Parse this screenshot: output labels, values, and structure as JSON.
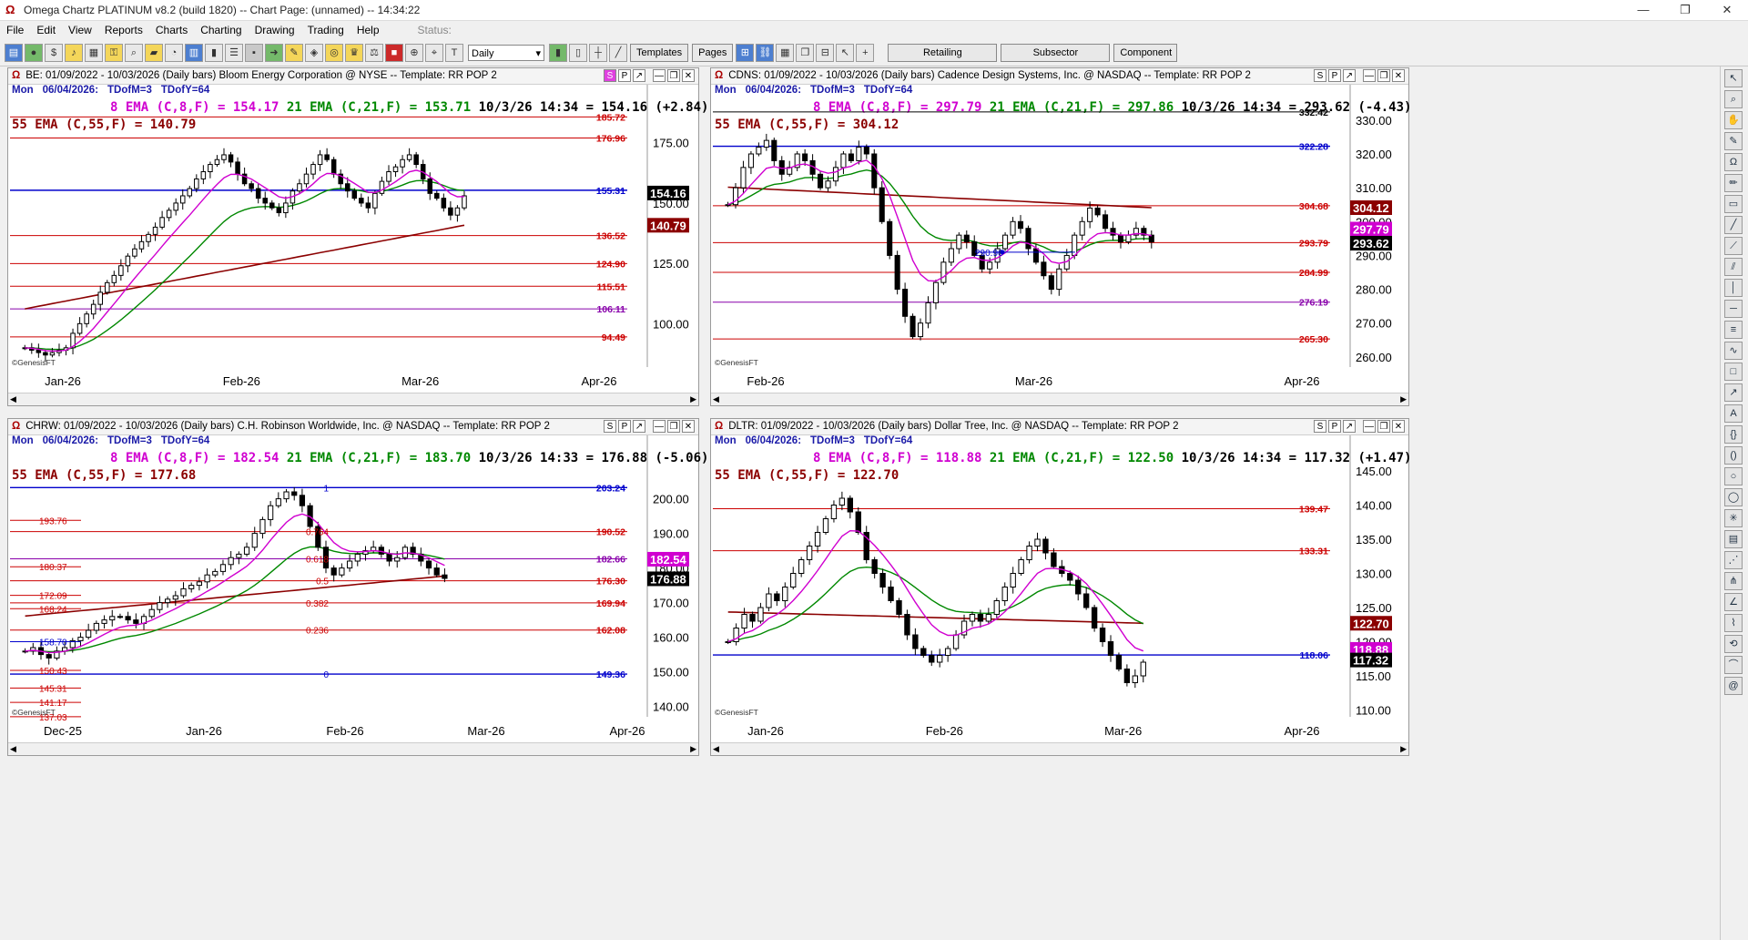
{
  "window": {
    "title": "Omega Chartz PLATINUM v8.2 (build 1820)  --  Chart Page: (unnamed)  --  14:34:22",
    "controls": [
      "—",
      "❐",
      "✕"
    ]
  },
  "menu": {
    "items": [
      "File",
      "Edit",
      "View",
      "Reports",
      "Charts",
      "Charting",
      "Drawing",
      "Trading",
      "Help"
    ],
    "status_label": "Status:"
  },
  "toolbar": {
    "interval": "Daily",
    "buttons": [
      "Templates",
      "Pages"
    ],
    "wide_buttons": [
      "Retailing",
      "Subsector",
      "Component"
    ]
  },
  "pane_buttons": [
    "S",
    "P",
    "↗",
    "—",
    "❐",
    "✕"
  ],
  "genesis": "©GenesisFT",
  "panes": [
    {
      "id": "be",
      "header": "BE:  01/09/2022 - 10/03/2026  (Daily bars)   Bloom Energy Corporation @ NYSE  --  Template: RR POP 2",
      "mon": "Mon",
      "date": "06/04/2026:",
      "tdofm": "TDofM=3",
      "tdofy": "TDofY=64",
      "ema8": "8 EMA (C,8,F) = 154.17",
      "ema21": "21 EMA (C,21,F) = 153.71",
      "quote": "10/3/26 14:34 = 154.16 (+2.84)",
      "ema55": "55 EMA (C,55,F) = 140.79",
      "xlabels": [
        "Jan-26",
        "Feb-26",
        "Mar-26",
        "Apr-26"
      ],
      "chart_data": {
        "type": "candlestick",
        "ylim": [
          82,
          190
        ],
        "yticks": [
          "175.00",
          "150.00",
          "125.00",
          "100.00"
        ],
        "levels": [
          {
            "v": 185.72,
            "label": "185.72",
            "color": "#cc0000"
          },
          {
            "v": 176.96,
            "label": "176.96",
            "color": "#cc0000"
          },
          {
            "v": 155.31,
            "label": "155.31",
            "color": "#0000cc"
          },
          {
            "v": 136.52,
            "label": "136.52",
            "color": "#cc0000"
          },
          {
            "v": 124.9,
            "label": "124.90",
            "color": "#cc0000"
          },
          {
            "v": 115.51,
            "label": "115.51",
            "color": "#cc0000"
          },
          {
            "v": 106.11,
            "label": "106.11",
            "color": "#8800aa"
          },
          {
            "v": 94.49,
            "label": "94.49",
            "color": "#cc0000"
          }
        ],
        "tags": [
          {
            "v": 154.16,
            "label": "154.16",
            "bg": "#000000"
          },
          {
            "v": 140.79,
            "label": "140.79",
            "bg": "#8b0000"
          }
        ],
        "close": [
          90,
          89,
          88,
          87,
          88,
          89,
          90,
          96,
          100,
          104,
          108,
          113,
          117,
          120,
          124,
          128,
          131,
          134,
          137,
          140,
          144,
          147,
          150,
          153,
          156,
          160,
          163,
          166,
          168,
          170,
          167,
          162,
          158,
          156,
          152,
          150,
          148,
          146,
          150,
          155,
          158,
          162,
          166,
          170,
          168,
          162,
          158,
          155,
          152,
          150,
          148,
          154,
          159,
          163,
          165,
          168,
          170,
          166,
          160,
          154,
          152,
          148,
          145,
          148,
          153
        ],
        "ema55_end": 140.79,
        "ema8_end": 154.17,
        "ema21_end": 153.71
      }
    },
    {
      "id": "cdns",
      "header": "CDNS:  01/09/2022 - 10/03/2026  (Daily bars)   Cadence Design Systems, Inc. @ NASDAQ  --  Template: RR POP 2",
      "mon": "Mon",
      "date": "06/04/2026:",
      "tdofm": "TDofM=3",
      "tdofy": "TDofY=64",
      "ema8": "8 EMA (C,8,F) = 297.79",
      "ema21": "21 EMA (C,21,F) = 297.86",
      "quote": "10/3/26 14:34 = 293.62 (-4.43)",
      "ema55": "55 EMA (C,55,F) = 304.12",
      "xlabels": [
        "Feb-26",
        "Mar-26",
        "Apr-26"
      ],
      "chart_data": {
        "type": "candlestick",
        "ylim": [
          257,
          334
        ],
        "yticks": [
          "330.00",
          "320.00",
          "310.00",
          "300.00",
          "290.00",
          "280.00",
          "270.00",
          "260.00"
        ],
        "levels": [
          {
            "v": 332.42,
            "label": "332.42",
            "color": "#000000"
          },
          {
            "v": 322.28,
            "label": "322.28",
            "color": "#0000cc"
          },
          {
            "v": 304.68,
            "label": "304.68",
            "color": "#cc0000"
          },
          {
            "v": 293.79,
            "label": "293.79",
            "color": "#cc0000"
          },
          {
            "v": 284.99,
            "label": "284.99",
            "color": "#cc0000"
          },
          {
            "v": 276.19,
            "label": "276.19",
            "color": "#8800aa"
          },
          {
            "v": 265.3,
            "label": "265.30",
            "color": "#cc0000"
          }
        ],
        "inline_label": "290.96",
        "tags": [
          {
            "v": 304.12,
            "label": "304.12",
            "bg": "#8b0000"
          },
          {
            "v": 297.79,
            "label": "297.79",
            "bg": "#d000d0"
          },
          {
            "v": 293.62,
            "label": "293.62",
            "bg": "#000000"
          }
        ],
        "close": [
          305,
          310,
          316,
          320,
          322,
          324,
          318,
          314,
          316,
          320,
          318,
          314,
          310,
          312,
          316,
          320,
          318,
          322,
          320,
          310,
          300,
          290,
          280,
          272,
          266,
          270,
          276,
          282,
          288,
          292,
          296,
          294,
          290,
          286,
          288,
          292,
          296,
          300,
          298,
          292,
          288,
          284,
          280,
          286,
          290,
          296,
          300,
          304,
          302,
          298,
          296,
          294,
          296,
          298,
          296,
          294
        ],
        "ema55_end": 304.12,
        "ema8_end": 297.79,
        "ema21_end": 297.86
      }
    },
    {
      "id": "chrw",
      "header": "CHRW:  01/09/2022 - 10/03/2026  (Daily bars)   C.H. Robinson Worldwide, Inc. @ NASDAQ  --  Template: RR POP 2",
      "mon": "Mon",
      "date": "06/04/2026:",
      "tdofm": "TDofM=3",
      "tdofy": "TDofY=64",
      "ema8": "8 EMA (C,8,F) = 182.54",
      "ema21": "21 EMA (C,21,F) = 183.70",
      "quote": "10/3/26 14:33 = 176.88 (-5.06)",
      "ema55": "55 EMA (C,55,F) = 177.68",
      "xlabels": [
        "Dec-25",
        "Jan-26",
        "Feb-26",
        "Mar-26",
        "Apr-26"
      ],
      "chart_data": {
        "type": "candlestick",
        "ylim": [
          137,
          212
        ],
        "yticks": [
          "200.00",
          "190.00",
          "180.00",
          "170.00",
          "160.00",
          "150.00",
          "140.00"
        ],
        "levels": [
          {
            "v": 203.24,
            "label": "203.24",
            "color": "#0000cc"
          },
          {
            "v": 190.52,
            "label": "190.52",
            "color": "#cc0000"
          },
          {
            "v": 182.66,
            "label": "182.66",
            "color": "#8800aa"
          },
          {
            "v": 176.3,
            "label": "176.30",
            "color": "#cc0000"
          },
          {
            "v": 169.94,
            "label": "169.94",
            "color": "#cc0000"
          },
          {
            "v": 162.08,
            "label": "162.08",
            "color": "#cc0000"
          },
          {
            "v": 149.36,
            "label": "149.36",
            "color": "#0000cc"
          }
        ],
        "fib_labels": [
          "1",
          "0.764",
          "0.618",
          "0.5",
          "0.382",
          "0.236",
          "0"
        ],
        "left_levels": [
          "193.76",
          "180.37",
          "172.09",
          "168.24",
          "158.70",
          "150.43",
          "145.31",
          "141.17",
          "137.03"
        ],
        "tags": [
          {
            "v": 182.54,
            "label": "182.54",
            "bg": "#d000d0"
          },
          {
            "v": 176.88,
            "label": "176.88",
            "bg": "#000000"
          }
        ],
        "close": [
          156,
          157,
          155,
          154,
          156,
          157,
          159,
          160,
          162,
          164,
          165,
          166,
          166,
          165,
          164,
          166,
          168,
          170,
          171,
          172,
          174,
          175,
          176,
          178,
          179,
          181,
          183,
          184,
          186,
          190,
          194,
          198,
          200,
          202,
          201,
          198,
          192,
          186,
          180,
          178,
          180,
          182,
          184,
          185,
          186,
          184,
          182,
          183,
          186,
          184,
          182,
          180,
          178,
          177
        ],
        "ema55_end": 177.68,
        "ema8_end": 182.54,
        "ema21_end": 183.7
      }
    },
    {
      "id": "dltr",
      "header": "DLTR:  01/09/2022 - 10/03/2026  (Daily bars)   Dollar Tree, Inc. @ NASDAQ  --  Template: RR POP 2",
      "mon": "Mon",
      "date": "06/04/2026:",
      "tdofm": "TDofM=3",
      "tdofy": "TDofY=64",
      "ema8": "8 EMA (C,8,F) = 118.88",
      "ema21": "21 EMA (C,21,F) = 122.50",
      "quote": "10/3/26 14:34 = 117.32 (+1.47)",
      "ema55": "55 EMA (C,55,F) = 122.70",
      "xlabels": [
        "Jan-26",
        "Feb-26",
        "Mar-26",
        "Apr-26"
      ],
      "chart_data": {
        "type": "candlestick",
        "ylim": [
          109,
          147
        ],
        "yticks": [
          "145.00",
          "140.00",
          "135.00",
          "130.00",
          "125.00",
          "120.00",
          "115.00",
          "110.00"
        ],
        "levels": [
          {
            "v": 139.47,
            "label": "139.47",
            "color": "#cc0000"
          },
          {
            "v": 133.31,
            "label": "133.31",
            "color": "#cc0000"
          },
          {
            "v": 118.06,
            "label": "118.06",
            "color": "#0000cc"
          }
        ],
        "tags": [
          {
            "v": 122.7,
            "label": "122.70",
            "bg": "#8b0000"
          },
          {
            "v": 118.88,
            "label": "118.88",
            "bg": "#d000d0"
          },
          {
            "v": 117.32,
            "label": "117.32",
            "bg": "#000000"
          }
        ],
        "close": [
          120,
          122,
          124,
          123,
          125,
          127,
          126,
          128,
          130,
          132,
          134,
          136,
          138,
          140,
          141,
          139,
          136,
          132,
          130,
          128,
          126,
          124,
          121,
          119,
          118,
          117,
          118,
          119,
          121,
          123,
          124,
          123,
          124,
          126,
          128,
          130,
          132,
          134,
          135,
          133,
          131,
          130,
          129,
          127,
          125,
          122,
          120,
          118,
          116,
          114,
          115,
          117
        ],
        "ema55_end": 122.7,
        "ema8_end": 118.88,
        "ema21_end": 122.5
      }
    }
  ]
}
